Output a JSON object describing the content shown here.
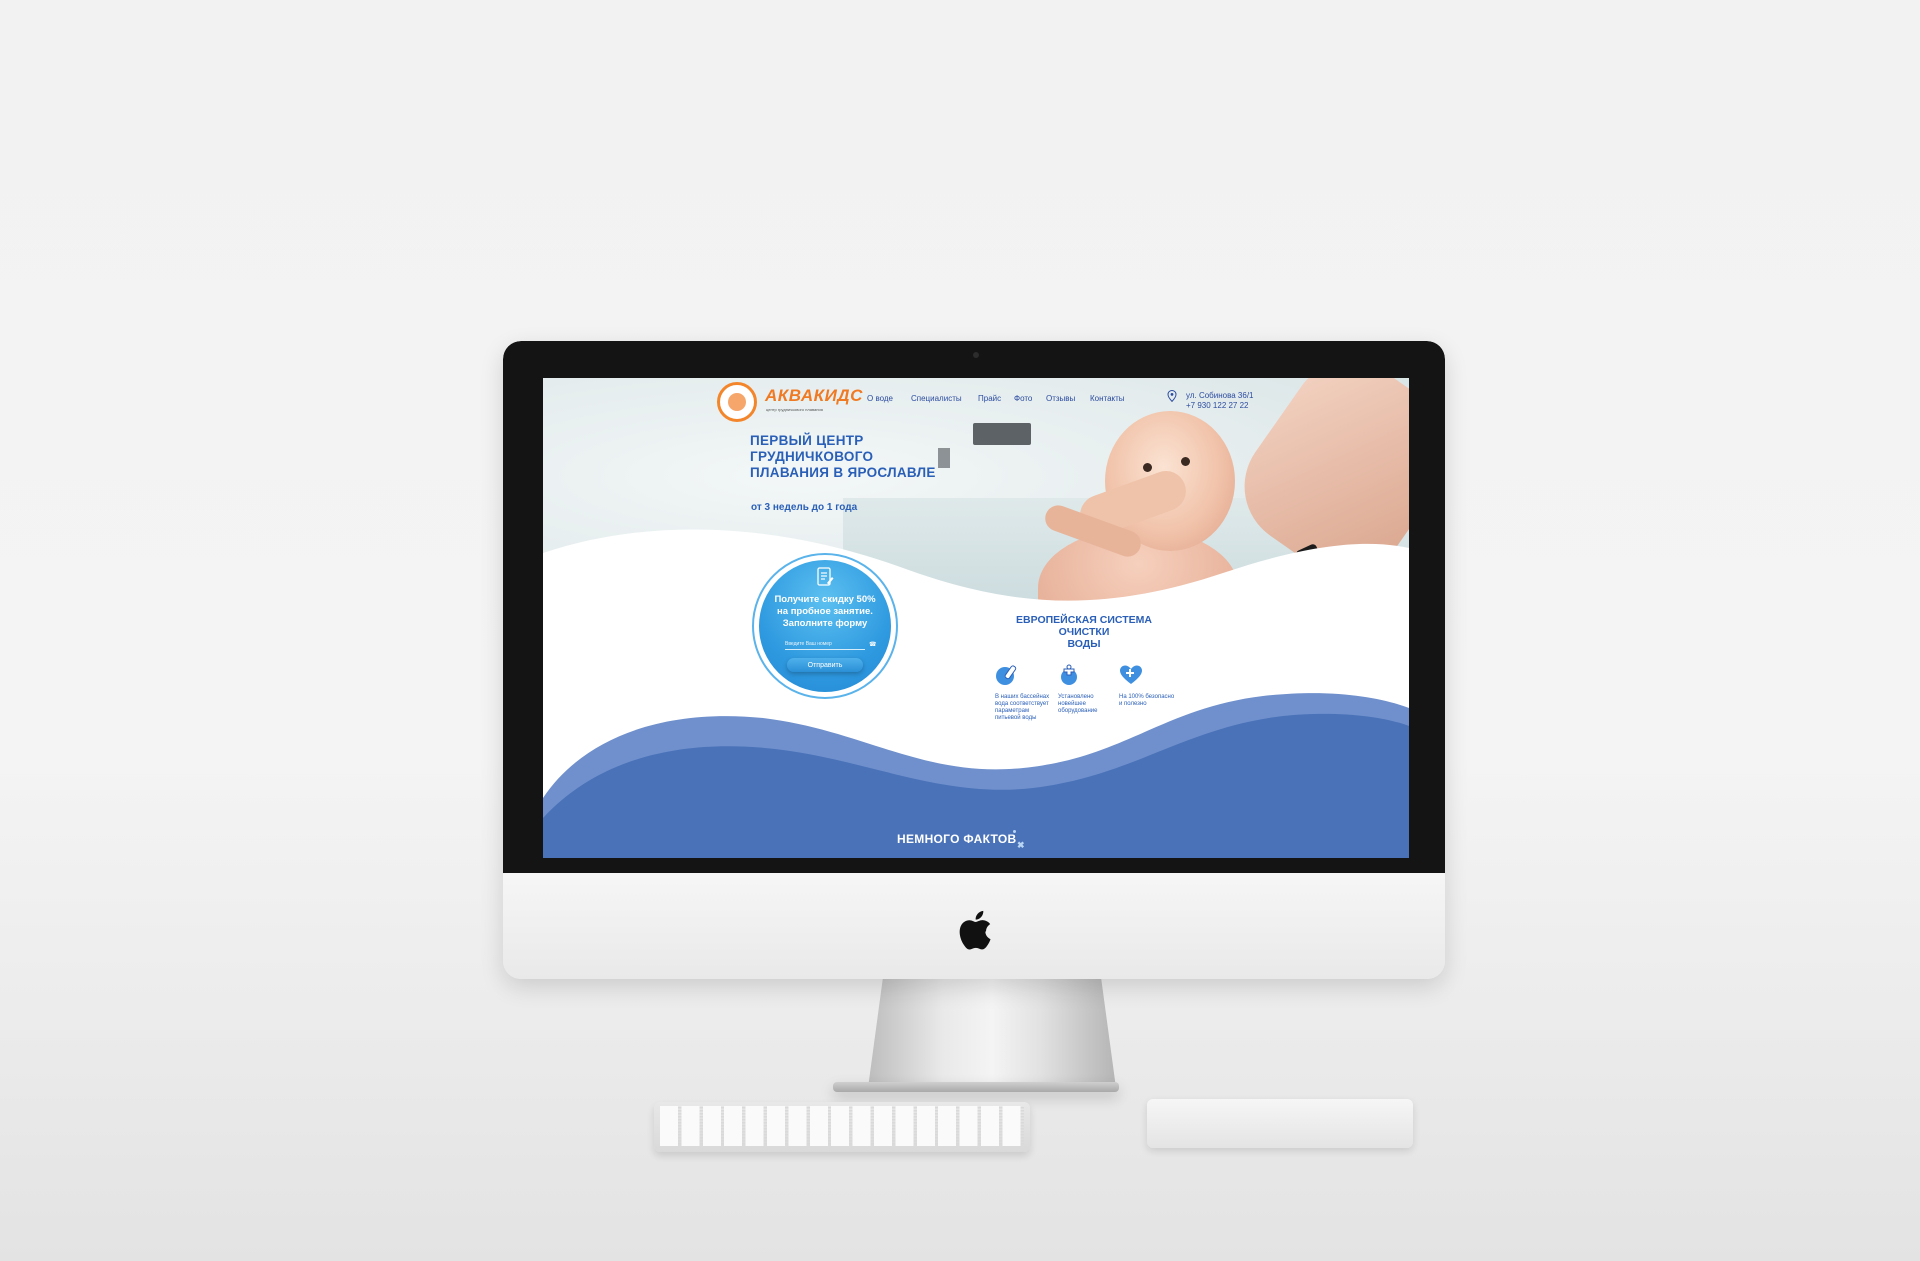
{
  "site": {
    "brand": "АКВАКИДС",
    "brand_tagline": "центр грудничкового плавания",
    "nav": [
      "О воде",
      "Специалисты",
      "Прайс",
      "Фото",
      "Отзывы",
      "Контакты"
    ],
    "address": "ул. Собинова 36/1",
    "phone": "+7 930 122 27 22"
  },
  "hero": {
    "title_lines": [
      "ПЕРВЫЙ ЦЕНТР",
      "ГРУДНИЧКОВОГО",
      "ПЛАВАНИЯ В ЯРОСЛАВЛЕ"
    ],
    "subtitle": "от 3 недель до 1 года"
  },
  "form": {
    "text_lines": [
      "Получите скидку 50%",
      "на пробное занятие.",
      "Заполните форму"
    ],
    "phone_placeholder": "Введите Ваш номер",
    "submit_label": "Отправить"
  },
  "water": {
    "title_lines": [
      "ЕВРОПЕЙСКАЯ СИСТЕМА ОЧИСТКИ",
      "ВОДЫ"
    ],
    "features": [
      {
        "icon": "water-bottle-icon",
        "text": "В наших бассейнах вода соответствует параметрам питьевой воды"
      },
      {
        "icon": "faucet-icon",
        "text": "Установлено новейшее оборудование"
      },
      {
        "icon": "heart-plus-icon",
        "text": "На 100% безопасно и полезно"
      }
    ]
  },
  "facts": {
    "title": "НЕМНОГО ФАКТОВ"
  },
  "colors": {
    "brand_orange": "#f07a23",
    "primary_blue": "#2a5fb8",
    "wave_blue": "#4a72b8",
    "accent_cyan": "#2f9ae0"
  }
}
